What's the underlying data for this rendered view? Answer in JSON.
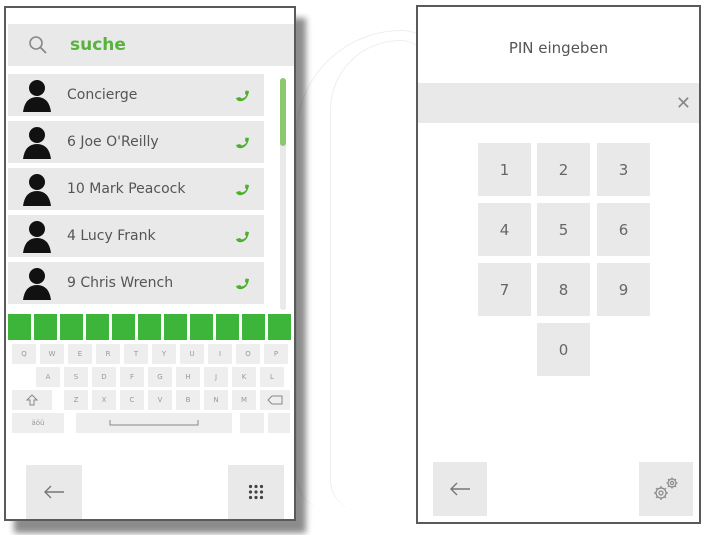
{
  "search": {
    "value": "suche"
  },
  "contacts": [
    {
      "name": "Concierge"
    },
    {
      "name": "6 Joe O'Reilly"
    },
    {
      "name": "10 Mark Peacock"
    },
    {
      "name": "4 Lucy Frank"
    },
    {
      "name": "9 Chris Wrench"
    }
  ],
  "keyboard": {
    "row1": [
      "Q",
      "W",
      "E",
      "R",
      "T",
      "Y",
      "U",
      "I",
      "O",
      "P"
    ],
    "row2": [
      "A",
      "S",
      "D",
      "F",
      "G",
      "H",
      "J",
      "K",
      "L"
    ],
    "row3": [
      "Z",
      "X",
      "C",
      "V",
      "B",
      "N",
      "M"
    ],
    "abc_key": "äöü"
  },
  "pin": {
    "title": "PIN eingeben",
    "keys": [
      "1",
      "2",
      "3",
      "4",
      "5",
      "6",
      "7",
      "8",
      "9",
      "0"
    ]
  },
  "colors": {
    "accent": "#3db43a",
    "search_text": "#57b33e",
    "key_bg": "#e9e9e9"
  },
  "icons": {
    "search": "search-icon",
    "phone": "phone-icon",
    "back": "back-arrow-icon",
    "grid": "keypad-icon",
    "gear": "gear-icon",
    "clear": "clear-icon"
  }
}
